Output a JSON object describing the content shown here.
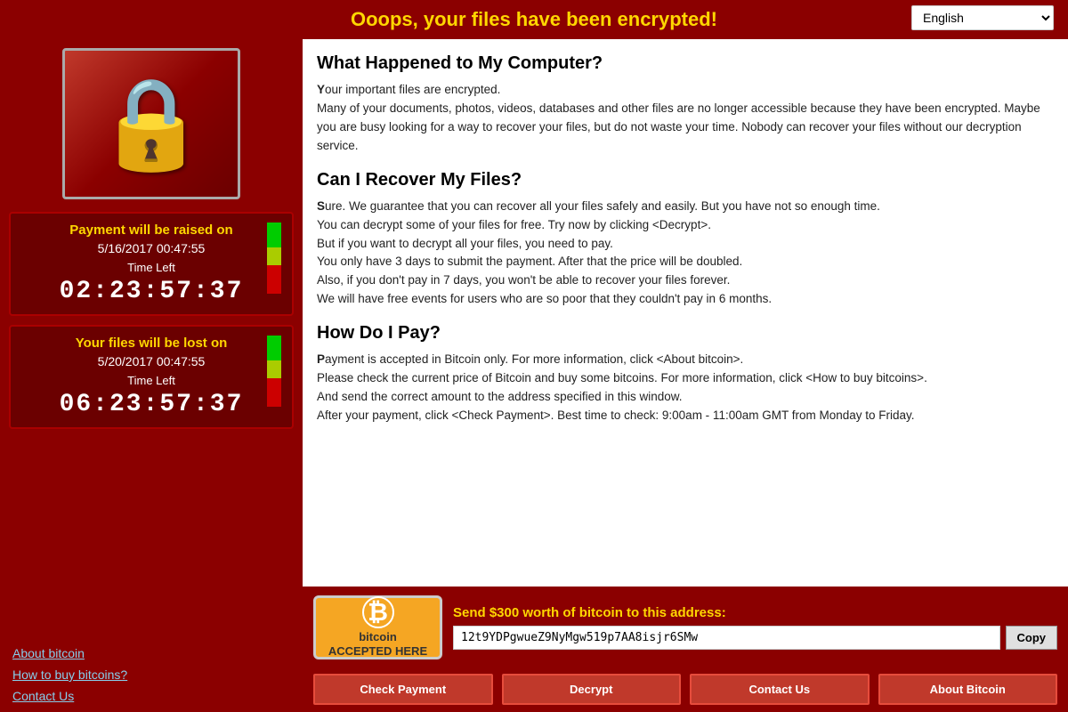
{
  "header": {
    "title": "Ooops, your files have been encrypted!",
    "language": "English"
  },
  "left": {
    "timer1": {
      "label": "Payment will be raised on",
      "date": "5/16/2017 00:47:55",
      "time_label": "Time Left",
      "time_display": "02:23:57:37"
    },
    "timer2": {
      "label": "Your files will be lost on",
      "date": "5/20/2017 00:47:55",
      "time_label": "Time Left",
      "time_display": "06:23:57:37"
    },
    "links": [
      {
        "text": "About bitcoin"
      },
      {
        "text": "How to buy bitcoins?"
      },
      {
        "text": "Contact Us"
      }
    ]
  },
  "right": {
    "sections": [
      {
        "title": "What Happened to My Computer?",
        "body": "Your important files are encrypted.\nMany of your documents, photos, videos, databases and other files are no longer accessible because they have been encrypted. Maybe you are busy looking for a way to recover your files, but do not waste your time. Nobody can recover your files without our decryption service."
      },
      {
        "title": "Can I Recover My Files?",
        "body": "Sure. We guarantee that you can recover all your files safely and easily. But you have not so enough time.\nYou can decrypt some of your files for free. Try now by clicking <Decrypt>.\nBut if you want to decrypt all your files, you need to pay.\nYou only have 3 days to submit the payment. After that the price will be doubled.\nAlso, if you don't pay in 7 days, you won't be able to recover your files forever.\nWe will have free events for users who are so poor that they couldn't pay in 6 months."
      },
      {
        "title": "How Do I Pay?",
        "body": "Payment is accepted in Bitcoin only. For more information, click <About bitcoin>.\nPlease check the current price of Bitcoin and buy some bitcoins. For more information, click <How to buy bitcoins>.\nAnd send the correct amount to the address specified in this window.\nAfter your payment, click <Check Payment>. Best time to check: 9:00am - 11:00am GMT from Monday to Friday."
      }
    ],
    "bitcoin": {
      "logo_line1": "bitcoin",
      "logo_line2": "ACCEPTED HERE",
      "send_label": "Send $300 worth of bitcoin to this address:",
      "address": "12t9YDPgwueZ9NyMgw519p7AA8isjr6SMw",
      "copy_label": "Copy"
    },
    "buttons": [
      {
        "label": "Check Payment"
      },
      {
        "label": "Decrypt"
      },
      {
        "label": "Contact Us"
      },
      {
        "label": "About Bitcoin"
      }
    ]
  }
}
